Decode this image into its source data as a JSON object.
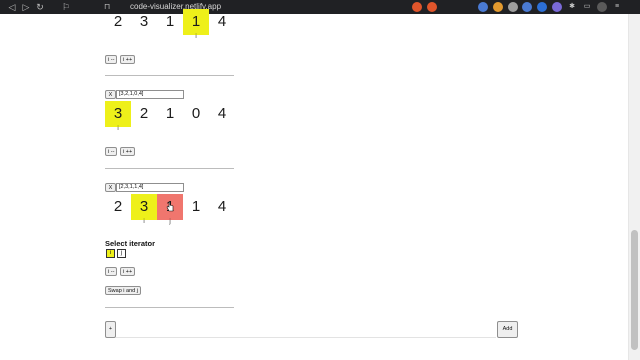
{
  "browser": {
    "url": "code-visualizer.netlify.app"
  },
  "array1": {
    "values": [
      "2",
      "3",
      "1",
      "1",
      "4"
    ],
    "pointer_label": "i"
  },
  "array2": {
    "input_value": "[3,2,1,0,4]",
    "remove_label": "X",
    "values": [
      "3",
      "2",
      "1",
      "0",
      "4"
    ],
    "pointer_label": "i"
  },
  "array3": {
    "input_value": "[2,3,1,1,4]",
    "remove_label": "X",
    "values": [
      "2",
      "3",
      "1",
      "1",
      "4"
    ],
    "pointer_i": "i",
    "pointer_j": "j",
    "select_label": "Select iterator",
    "iter_i": "i",
    "iter_j": "j",
    "swap_label": "Swap i and j"
  },
  "controls": {
    "decrement_label": "i --",
    "increment_label": "i ++"
  },
  "add_row": {
    "plus_label": "+",
    "add_label": "Add"
  },
  "colors": {
    "highlight_i": "#eef01a",
    "highlight_j": "#f0766e"
  }
}
